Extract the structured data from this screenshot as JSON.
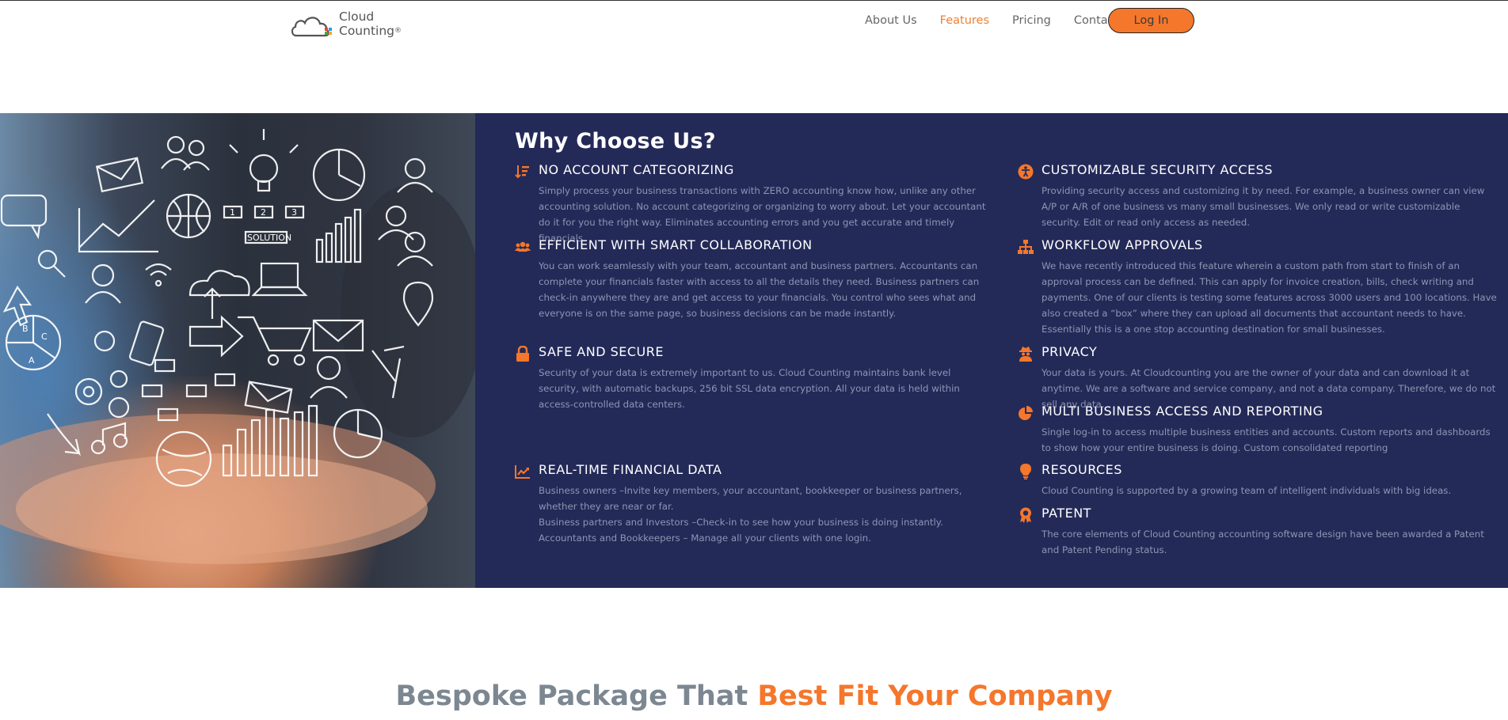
{
  "header": {
    "logo_line1": "Cloud",
    "logo_line2": "Counting",
    "logo_reg": "®",
    "nav": {
      "about": "About Us",
      "features": "Features",
      "pricing": "Pricing",
      "contact": "Contact"
    },
    "login_label": "Log In",
    "active_nav": "Features"
  },
  "colors": {
    "accent": "#f4772c",
    "panel": "#232a58",
    "body_text": "#8e95b2"
  },
  "section_title": "Why Choose Us?",
  "features_left": [
    {
      "icon": "sort-descending-icon",
      "title": "NO ACCOUNT CATEGORIZING",
      "text": "Simply process your business transactions with ZERO accounting know how, unlike any other accounting solution. No account categorizing or organizing to worry about. Let your accountant do it for you the right way. Eliminates accounting errors and you get accurate and timely financials."
    },
    {
      "icon": "users-icon",
      "title": "EFFICIENT WITH SMART COLLABORATION",
      "text": "You can work seamlessly with your team, accountant and business partners. Accountants can complete your financials faster with access to all the details they need. Business partners can check-in anywhere they are and get access to your financials. You control who sees what and everyone is on the same page, so business decisions can be made instantly."
    },
    {
      "icon": "lock-icon",
      "title": "SAFE AND SECURE",
      "text": "Security of your data is extremely important to us. Cloud Counting maintains bank level security, with automatic backups, 256 bit SSL data encryption. All your data is held within access-controlled data centers."
    },
    {
      "icon": "line-chart-icon",
      "title": "REAL-TIME FINANCIAL DATA",
      "text_lines": [
        "Business owners –Invite key members, your accountant, bookkeeper or business partners, whether they are near or far.",
        "Business partners and Investors –Check-in to see how your business is doing instantly.",
        "Accountants and Bookkeepers – Manage all your clients with one login."
      ]
    }
  ],
  "features_right": [
    {
      "icon": "universal-access-icon",
      "title": "CUSTOMIZABLE SECURITY ACCESS",
      "text": "Providing security access and customizing it by need. For example, a business owner can view A/P or A/R of one business vs many small businesses. We only read or write customizable security. Edit or read only access as needed."
    },
    {
      "icon": "sitemap-icon",
      "title": "WORKFLOW APPROVALS",
      "text": "We have recently introduced this feature wherein a custom path from start to finish of an approval process can be defined. This can apply for invoice creation, bills, check writing and payments. One of our clients is testing some features across 3000 users and 100 locations. Have also created a “box” where they can upload all documents that accountant needs to have. Essentially this is a one stop accounting destination for small businesses."
    },
    {
      "icon": "user-secret-icon",
      "title": "PRIVACY",
      "text": "Your data is yours. At Cloudcounting you are the owner of your data and can download it at anytime. We are a software and service company, and not a data company. Therefore, we do not sell any data."
    },
    {
      "icon": "pie-chart-icon",
      "title": "MULTI BUSINESS ACCESS AND REPORTING",
      "text": "Single log-in to access multiple business entities and accounts. Custom reports and dashboards to show how your entire business is doing. Custom consolidated reporting"
    },
    {
      "icon": "lightbulb-icon",
      "title": "RESOURCES",
      "text": "Cloud Counting is supported by a growing team of intelligent individuals with big ideas."
    },
    {
      "icon": "award-icon",
      "title": "PATENT",
      "text": "The core elements of Cloud Counting accounting software design have been awarded a Patent and Patent Pending status."
    }
  ],
  "hero_image": {
    "description_icon": "business-hand-icons-image",
    "labels": [
      "SOLUTION",
      "1",
      "2",
      "3",
      "A",
      "B",
      "C"
    ]
  },
  "bottom": {
    "heading_part1": "Bespoke Package That ",
    "heading_part2": "Best Fit Your Company"
  }
}
